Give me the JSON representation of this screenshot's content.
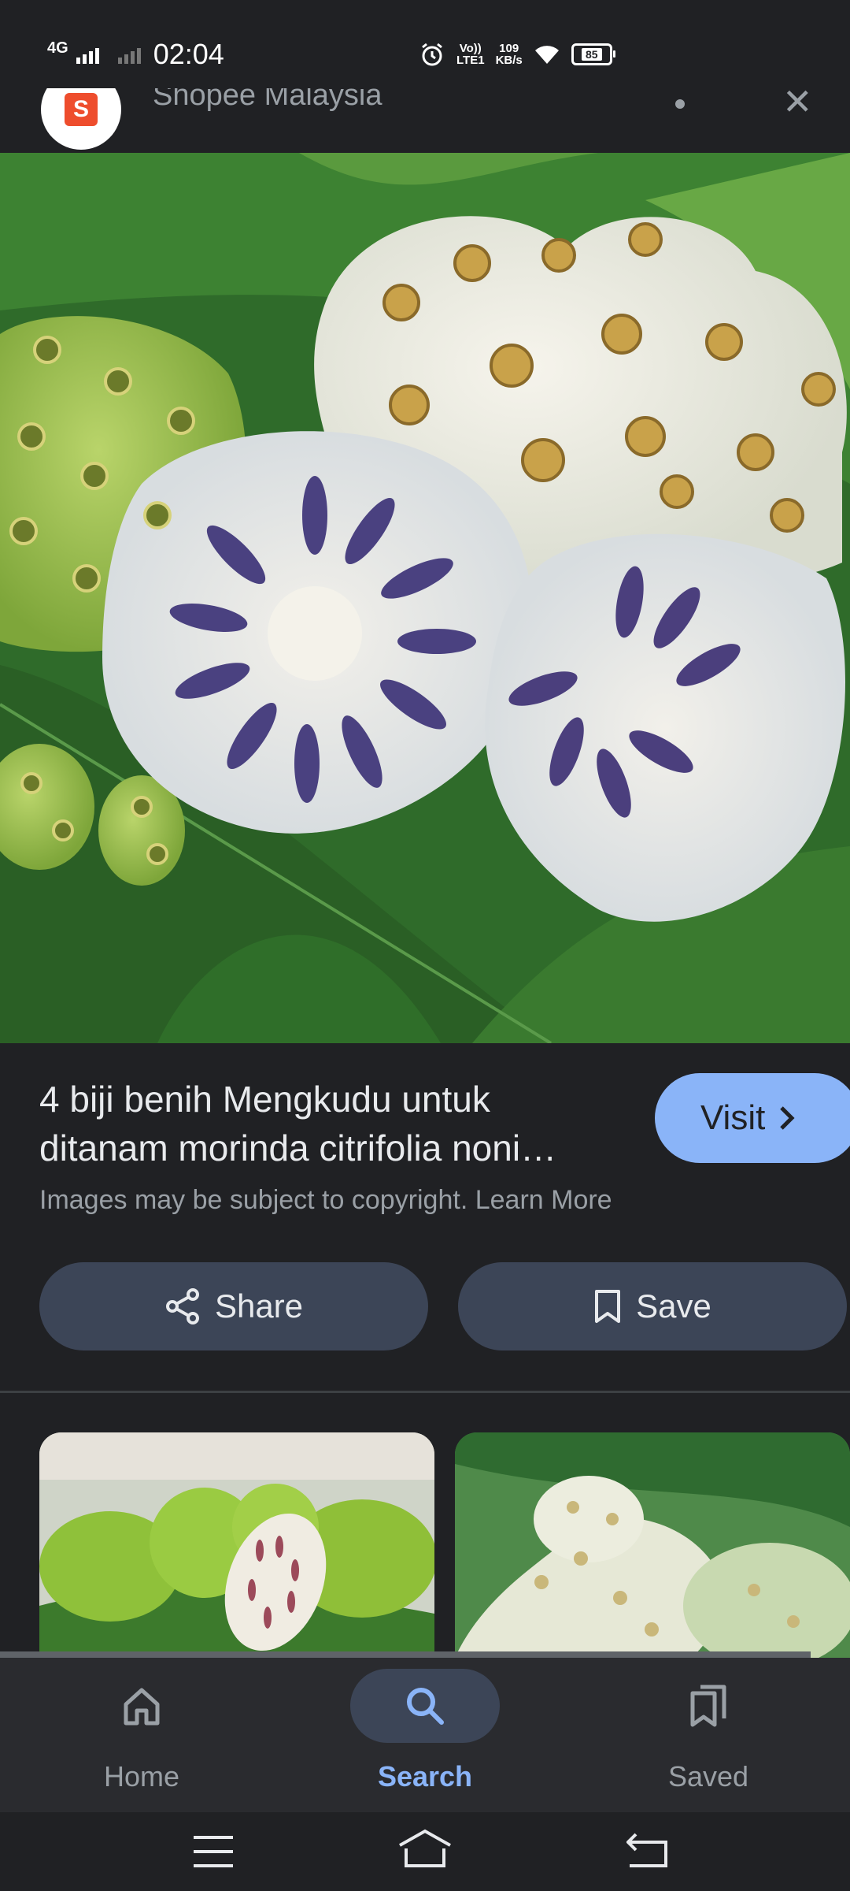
{
  "status_bar": {
    "network": "4G",
    "time": "02:04",
    "volte": "Vo))",
    "lte": "LTE1",
    "speed_value": "109",
    "speed_unit": "KB/s",
    "battery": "85"
  },
  "site": {
    "name": "Shopee Malaysia",
    "logo_letter": "S"
  },
  "result": {
    "title_line1": "4 biji benih Mengkudu untuk",
    "title_line2": "ditanam morinda citrifolia noni…",
    "visit_label": "Visit",
    "copyright_text": "Images may be subject to copyright. Learn More",
    "share_label": "Share",
    "save_label": "Save"
  },
  "bottom_nav": {
    "items": [
      {
        "label": "Home",
        "icon": "home-icon",
        "active": false
      },
      {
        "label": "Search",
        "icon": "search-icon",
        "active": true
      },
      {
        "label": "Saved",
        "icon": "saved-icon",
        "active": false
      }
    ]
  },
  "colors": {
    "background": "#202124",
    "accent": "#8ab4f8",
    "button_bg": "#3c4557",
    "shopee": "#ee4d2d"
  }
}
